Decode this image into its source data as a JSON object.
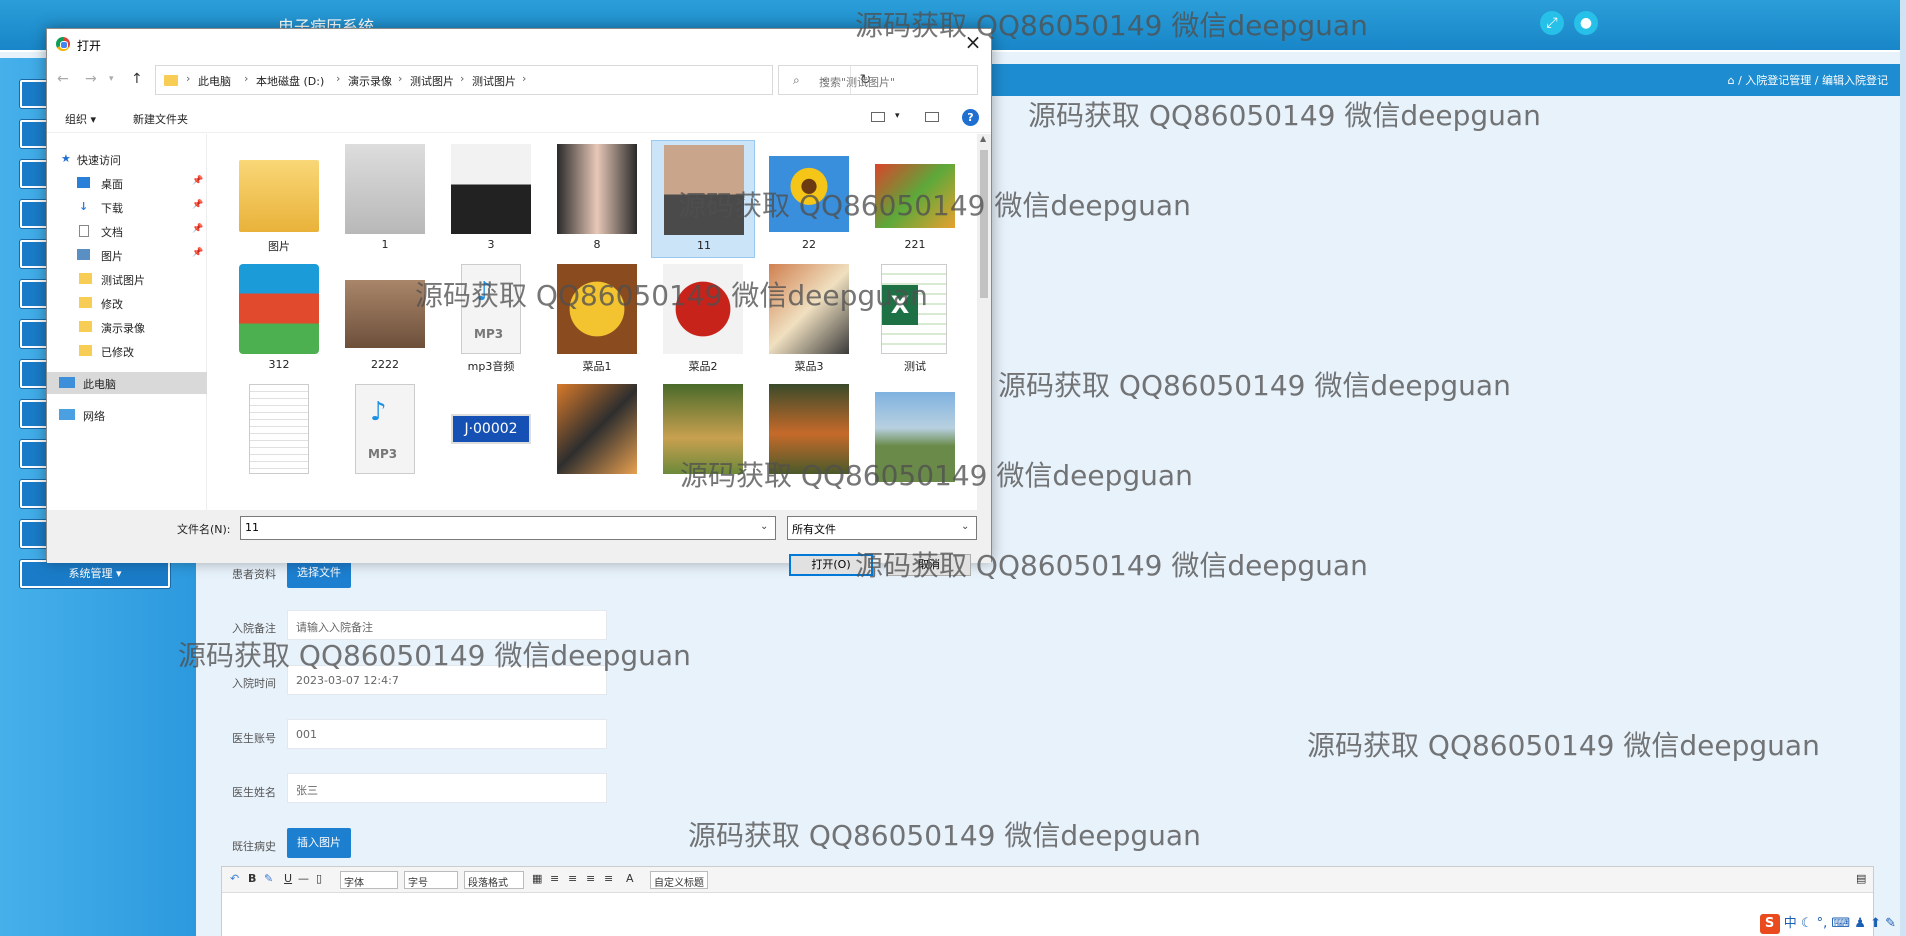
{
  "app": {
    "title": "电子病历系统",
    "breadcrumb": "⌂ / 入院登记管理 / 编辑入院登记",
    "sidebar_last_label": "系统管理 ▾"
  },
  "form": {
    "patient_file_label": "患者资料",
    "choose_file_button": "选择文件",
    "remark_label": "入院备注",
    "remark_placeholder": "请输入入院备注",
    "admit_time_label": "入院时间",
    "admit_time_value": "2023-03-07 12:4:7",
    "doctor_account_label": "医生账号",
    "doctor_account_value": "001",
    "doctor_name_label": "医生姓名",
    "doctor_name_value": "张三",
    "history_label": "既往病史",
    "insert_image_button": "插入图片"
  },
  "editor_toolbar": {
    "font_family": "字体",
    "font_size": "字号",
    "paragraph": "段落格式",
    "custom_title": "自定义标题"
  },
  "tray": {
    "ime": "S",
    "ime_mode": "中"
  },
  "watermark": "源码获取 QQ86050149 微信deepguan",
  "dialog": {
    "title": "打开",
    "path": [
      "此电脑",
      "本地磁盘 (D:)",
      "演示录像",
      "测试图片",
      "测试图片"
    ],
    "search_placeholder": "搜索\"测试图片\"",
    "organize": "组织 ▾",
    "new_folder": "新建文件夹",
    "nav": [
      {
        "label": "快速访问",
        "icon": "star-icon"
      },
      {
        "label": "桌面",
        "icon": "desktop-icon",
        "pinned": true
      },
      {
        "label": "下载",
        "icon": "download-icon",
        "pinned": true
      },
      {
        "label": "文档",
        "icon": "document-icon",
        "pinned": true
      },
      {
        "label": "图片",
        "icon": "picture-icon",
        "pinned": true
      },
      {
        "label": "测试图片",
        "icon": "folder-icon"
      },
      {
        "label": "修改",
        "icon": "folder-icon"
      },
      {
        "label": "演示录像",
        "icon": "folder-icon"
      },
      {
        "label": "已修改",
        "icon": "folder-icon"
      },
      {
        "label": "此电脑",
        "icon": "computer-icon",
        "selected": true
      },
      {
        "label": "网络",
        "icon": "network-icon"
      }
    ],
    "files": [
      {
        "name": "图片",
        "kind": "folder"
      },
      {
        "name": "1",
        "kind": "photo-woman"
      },
      {
        "name": "3",
        "kind": "photo-man"
      },
      {
        "name": "8",
        "kind": "photo-woman2"
      },
      {
        "name": "11",
        "kind": "photo-man2",
        "selected": true
      },
      {
        "name": "22",
        "kind": "photo-sunflower"
      },
      {
        "name": "221",
        "kind": "photo-vegetables"
      },
      {
        "name": "312",
        "kind": "archive"
      },
      {
        "name": "2222",
        "kind": "photo-bottles"
      },
      {
        "name": "mp3音频",
        "kind": "mp3"
      },
      {
        "name": "菜品1",
        "kind": "photo-dish1"
      },
      {
        "name": "菜品2",
        "kind": "photo-dish2"
      },
      {
        "name": "菜品3",
        "kind": "photo-dish3"
      },
      {
        "name": "测试",
        "kind": "excel"
      },
      {
        "name": "",
        "kind": "text"
      },
      {
        "name": "",
        "kind": "mp3"
      },
      {
        "name": "",
        "kind": "photo-plate"
      },
      {
        "name": "",
        "kind": "photo-tiger"
      },
      {
        "name": "",
        "kind": "photo-rabbit"
      },
      {
        "name": "",
        "kind": "photo-fox"
      },
      {
        "name": "",
        "kind": "photo-landscape"
      }
    ],
    "filename_label": "文件名(N):",
    "filename_value": "11",
    "filetype_value": "所有文件",
    "open_button": "打开(O)",
    "cancel_button": "取消",
    "plate_text": "J·00002",
    "mp3_text": "MP3"
  }
}
